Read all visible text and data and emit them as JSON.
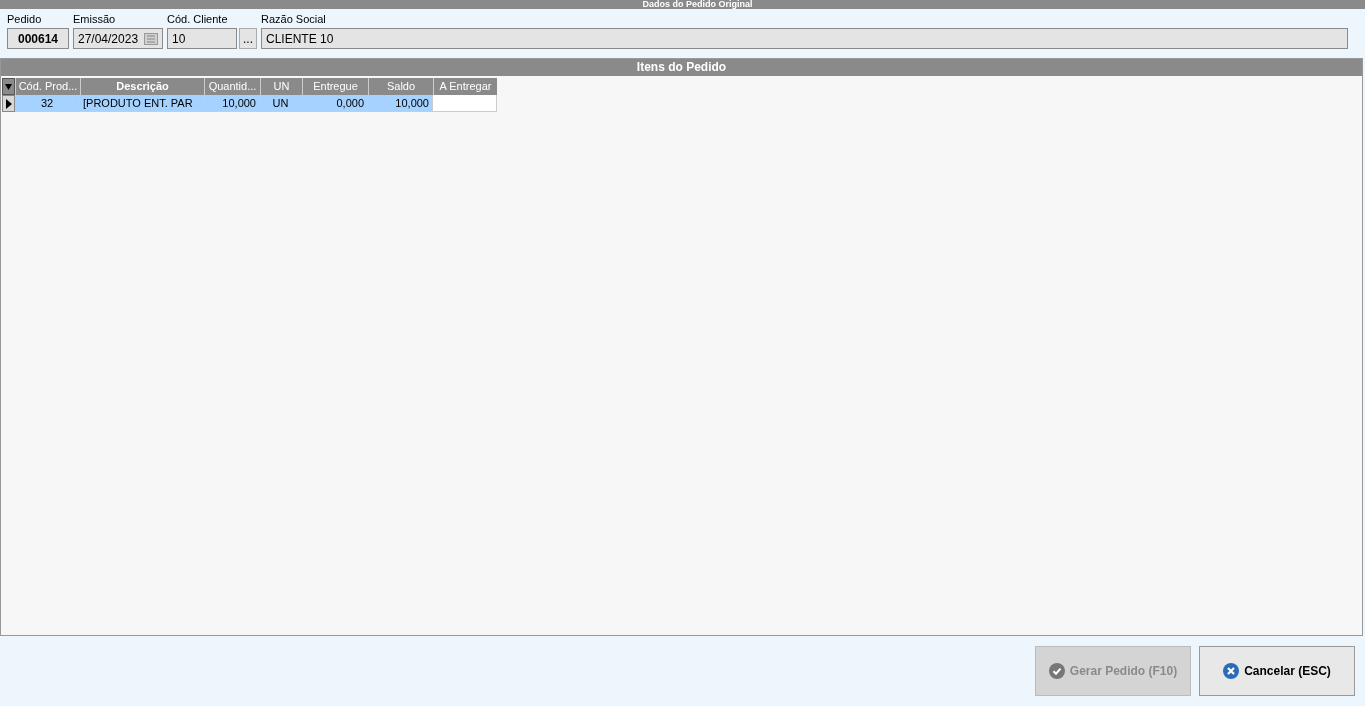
{
  "header": {
    "title": "Dados do Pedido Original"
  },
  "fields": [
    {
      "label": "Pedido",
      "value": "000614",
      "kind": "bold"
    },
    {
      "label": "Emissão",
      "value": "27/04/2023",
      "kind": "date"
    },
    {
      "label": "Cód. Cliente",
      "value": "10",
      "kind": "lookup",
      "button": "..."
    },
    {
      "label": "Razão Social",
      "value": "CLIENTE 10",
      "kind": "plain"
    }
  ],
  "items": {
    "title": "Itens do Pedido",
    "columns": [
      "Cód. Prod...",
      "Descrição",
      "Quantid...",
      "UN",
      "Entregue",
      "Saldo",
      "A Entregar"
    ],
    "rows": [
      {
        "selected": true,
        "cells": [
          "32",
          "[PRODUTO ENT. PAR",
          "10,000",
          "UN",
          "0,000",
          "10,000",
          ""
        ]
      }
    ]
  },
  "buttons": [
    {
      "label": "Gerar Pedido (F10)",
      "kind": "confirm",
      "disabled": true
    },
    {
      "label": "Cancelar (ESC)",
      "kind": "cancel",
      "disabled": false
    }
  ]
}
